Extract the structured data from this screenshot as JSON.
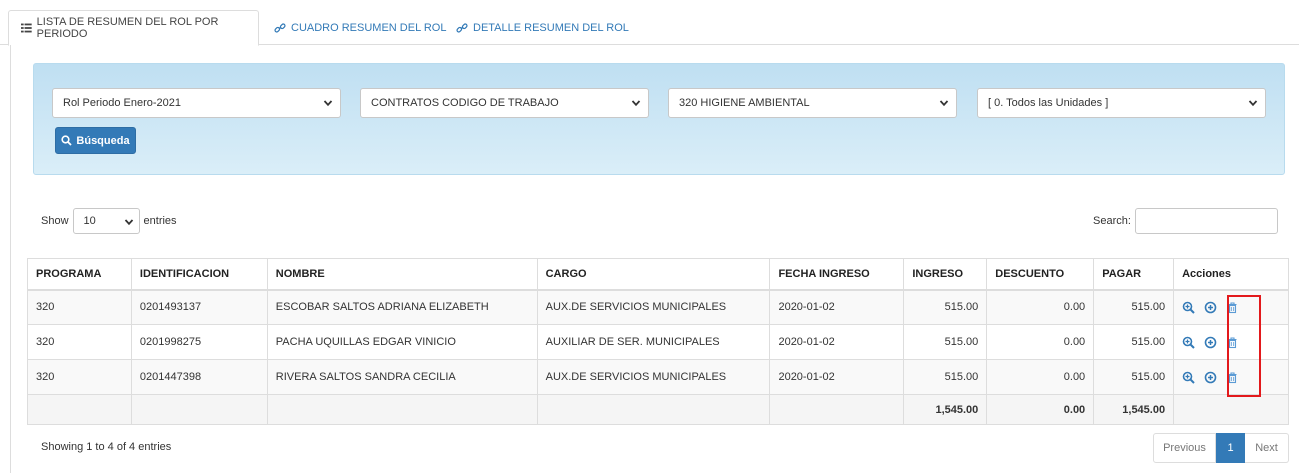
{
  "tabs": [
    {
      "label": "LISTA DE RESUMEN DEL ROL POR PERIODO",
      "icon": "list-icon",
      "active": true
    },
    {
      "label": "CUADRO RESUMEN DEL ROL",
      "icon": "link-icon",
      "active": false
    },
    {
      "label": "DETALLE RESUMEN DEL ROL",
      "icon": "link-icon",
      "active": false
    }
  ],
  "filters": {
    "periodo": "Rol Periodo Enero-2021",
    "contrato": "CONTRATOS CODIGO DE TRABAJO",
    "programa": "320 HIGIENE AMBIENTAL",
    "unidad": "[ 0. Todos las Unidades ]",
    "search_button": "Búsqueda"
  },
  "length": {
    "show_label": "Show",
    "value": "10",
    "entries_label": "entries"
  },
  "search": {
    "label": "Search:"
  },
  "table": {
    "headers": [
      "PROGRAMA",
      "IDENTIFICACION",
      "NOMBRE",
      "CARGO",
      "FECHA INGRESO",
      "INGRESO",
      "DESCUENTO",
      "PAGAR",
      "Acciones"
    ],
    "rows": [
      [
        "320",
        "0201493137",
        "ESCOBAR SALTOS ADRIANA ELIZABETH",
        "AUX.DE SERVICIOS MUNICIPALES",
        "2020-01-02",
        "515.00",
        "0.00",
        "515.00"
      ],
      [
        "320",
        "0201998275",
        "PACHA UQUILLAS EDGAR VINICIO",
        "AUXILIAR DE SER. MUNICIPALES",
        "2020-01-02",
        "515.00",
        "0.00",
        "515.00"
      ],
      [
        "320",
        "0201447398",
        "RIVERA SALTOS SANDRA CECILIA",
        "AUX.DE SERVICIOS MUNICIPALES",
        "2020-01-02",
        "515.00",
        "0.00",
        "515.00"
      ]
    ],
    "totals": {
      "ingreso": "1,545.00",
      "descuento": "0.00",
      "pagar": "1,545.00"
    }
  },
  "footer": {
    "info": "Showing 1 to 4 of 4 entries",
    "previous": "Previous",
    "current_page": "1",
    "next": "Next"
  },
  "colors": {
    "primary": "#337ab7",
    "panel": "#d4ebf7",
    "highlight": "#e3191c"
  }
}
